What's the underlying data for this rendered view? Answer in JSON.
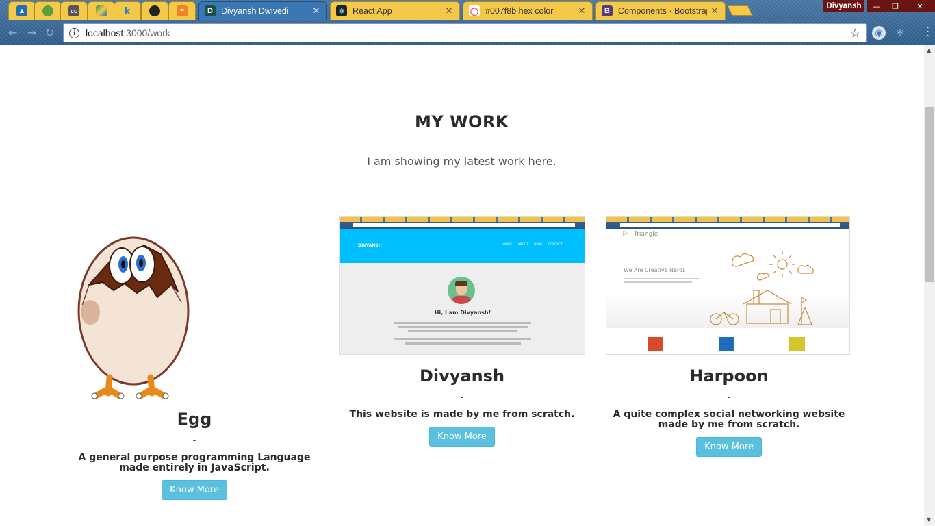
{
  "browser": {
    "pinned_tabs": [
      {
        "icon": "bird-icon",
        "color": "#1f6fb5"
      },
      {
        "icon": "nodejs-icon",
        "color": "#5b9f3b"
      },
      {
        "icon": "cc-icon",
        "color": "#555555"
      },
      {
        "icon": "drive-icon",
        "color": "#3b8f4a"
      },
      {
        "icon": "k-icon",
        "color": "#2a7fc9"
      },
      {
        "icon": "github-icon",
        "color": "#222222"
      },
      {
        "icon": "stack-icon",
        "color": "#f48024"
      }
    ],
    "tabs": [
      {
        "title": "Divyansh Dwivedi",
        "favicon_letter": "D",
        "favicon_color": "#1a4f4a",
        "active": true
      },
      {
        "title": "React App",
        "favicon_letter": "⚛",
        "favicon_color": "#222222",
        "active": false
      },
      {
        "title": "#007f8b hex color",
        "favicon_letter": "◯",
        "favicon_color": "#e44",
        "active": false
      },
      {
        "title": "Components · Bootstrap",
        "favicon_letter": "B",
        "favicon_color": "#563d7c",
        "active": false
      }
    ],
    "profile_name": "Divyansh",
    "url_host": "localhost",
    "url_path": ":3000/work"
  },
  "section": {
    "title": "MY WORK",
    "subtitle": "I am showing my latest work here."
  },
  "projects": [
    {
      "name": "Egg",
      "dash": "-",
      "description": "A general purpose programming Language made entirely in JavaScript.",
      "button_label": "Know More"
    },
    {
      "name": "Divyansh",
      "dash": "-",
      "description": "This website is made by me from scratch.",
      "button_label": "Know More",
      "preview": {
        "brand": "DIVYANSH",
        "nav": [
          "WORK",
          "ABOUT",
          "BLOG",
          "CONTACT"
        ],
        "greeting": "Hi, I am Divyansh!"
      }
    },
    {
      "name": "Harpoon",
      "dash": "-",
      "description": "A quite complex social networking website made by me from scratch.",
      "button_label": "Know More",
      "preview": {
        "brand": "Triangle",
        "tagline": "We Are Creative Nerds"
      }
    }
  ],
  "colors": {
    "button": "#5bc0de",
    "accent_blue": "#00bfff"
  }
}
